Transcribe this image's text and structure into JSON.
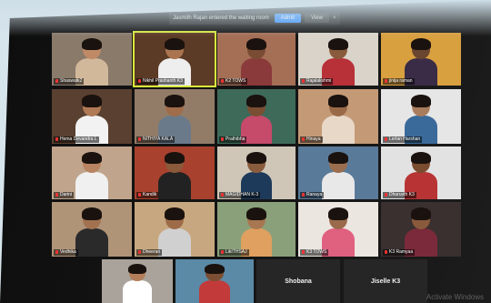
{
  "notification": {
    "message": "Jasmith Rajan entered the waiting room",
    "admit_label": "Admit",
    "view_label": "View",
    "close_glyph": "×"
  },
  "participants": [
    {
      "name": "Shaswatk2",
      "bg": "#8a7a6a",
      "shirt": "#d2b89a",
      "skin": "#c08a66"
    },
    {
      "name": "Nikhil Prashanth K3",
      "bg": "#5b3a26",
      "shirt": "#eeeeee",
      "skin": "#a9744f"
    },
    {
      "name": "K2 TOWS",
      "bg": "#a56f56",
      "shirt": "#8a3a3a",
      "skin": "#7a4c34"
    },
    {
      "name": "Rajalakshmi",
      "bg": "#d9d3c9",
      "shirt": "#b83038",
      "skin": "#8a5a3c"
    },
    {
      "name": "jinija raman",
      "bg": "#d9a040",
      "shirt": "#3a2c46",
      "skin": "#6a4630"
    },
    {
      "name": "Hema Devandra L",
      "bg": "#5a4030",
      "shirt": "#f2f2f2",
      "skin": "#b07a56"
    },
    {
      "name": "NITHIYA KALA",
      "bg": "#927c68",
      "shirt": "#6a7a8a",
      "skin": "#a06c4a"
    },
    {
      "name": "Prathibha",
      "bg": "#3e6a5a",
      "shirt": "#c64a6a",
      "skin": "#7a4e32"
    },
    {
      "name": "Hinaya",
      "bg": "#c49a76",
      "shirt": "#e8d8c8",
      "skin": "#9a6a48"
    },
    {
      "name": "Lerlan Harshan",
      "bg": "#e6e6e6",
      "shirt": "#3a6a9a",
      "skin": "#a87c5c"
    },
    {
      "name": "Darini",
      "bg": "#c0a48c",
      "shirt": "#f0f0f0",
      "skin": "#b88462"
    },
    {
      "name": "Kandik",
      "bg": "#a8412e",
      "shirt": "#222222",
      "skin": "#8a5a3a"
    },
    {
      "name": "MAGIDHAN K-3",
      "bg": "#cfc6b8",
      "shirt": "#1e3a5a",
      "skin": "#8a5c3e"
    },
    {
      "name": "Ranaya",
      "bg": "#5a7a9a",
      "shirt": "#e8e8e8",
      "skin": "#9a6e4e"
    },
    {
      "name": "Dhuruvth K3",
      "bg": "#e2e2e2",
      "shirt": "#b83434",
      "skin": "#7a4c30"
    },
    {
      "name": "Vedhika",
      "bg": "#b09478",
      "shirt": "#2a2a2a",
      "skin": "#a27250"
    },
    {
      "name": "Dheeran",
      "bg": "#c7a77f",
      "shirt": "#d0d0d0",
      "skin": "#9e6c48"
    },
    {
      "name": "LikITHSAJ",
      "bg": "#8aa07a",
      "shirt": "#e0a060",
      "skin": "#a87650"
    },
    {
      "name": "K3 TOWS",
      "bg": "#ece6e0",
      "shirt": "#e06080",
      "skin": "#9a6a4a"
    },
    {
      "name": "K3 Ramyaa",
      "bg": "#3a3030",
      "shirt": "#7a2a3a",
      "skin": "#8a5a3c"
    },
    {
      "name": "",
      "bg": "#a9a39b",
      "shirt": "#ffffff",
      "skin": "#b47e5a"
    },
    {
      "name": "",
      "bg": "#5a8aa6",
      "shirt": "#c23a3a",
      "skin": "#7c4e34"
    }
  ],
  "name_only_tiles": [
    {
      "name": "Shobana"
    },
    {
      "name": "Jiselle K3"
    }
  ],
  "watermark": "Activate Windows"
}
